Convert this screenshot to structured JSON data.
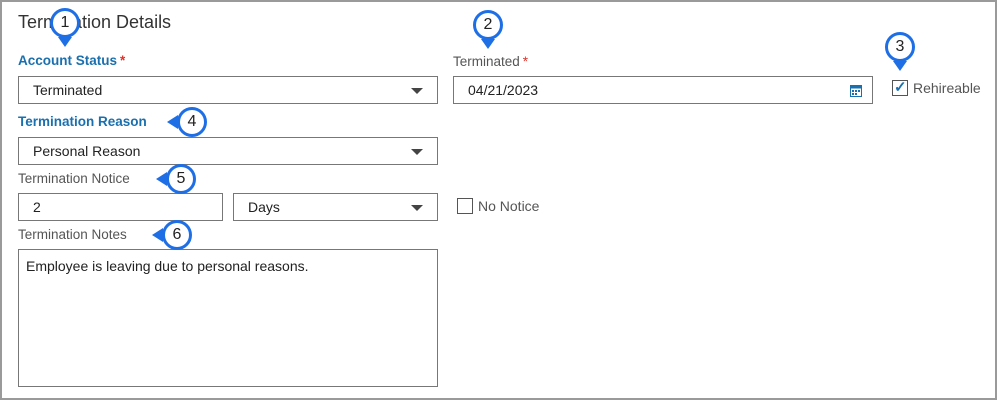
{
  "section": {
    "title": "Termination Details"
  },
  "account_status": {
    "label": "Account Status",
    "required": "*",
    "value": "Terminated"
  },
  "terminated": {
    "label": "Terminated",
    "required": "*",
    "date": "04/21/2023"
  },
  "rehireable": {
    "label": "Rehireable",
    "checked": true,
    "check_glyph": "✓"
  },
  "termination_reason": {
    "label": "Termination Reason",
    "value": "Personal Reason"
  },
  "termination_notice": {
    "label": "Termination Notice",
    "amount": "2",
    "unit": "Days"
  },
  "no_notice": {
    "label": "No Notice",
    "checked": false
  },
  "termination_notes": {
    "label": "Termination Notes",
    "text": "Employee is leaving due to personal reasons."
  },
  "callouts": [
    "1",
    "2",
    "3",
    "4",
    "5",
    "6"
  ],
  "icons": {
    "calendar": "calendar-icon",
    "dropdown": "chevron-down-icon"
  },
  "colors": {
    "label_blue": "#1a6fae",
    "required_red": "#d9342b",
    "callout_blue": "#1e6fe6"
  }
}
